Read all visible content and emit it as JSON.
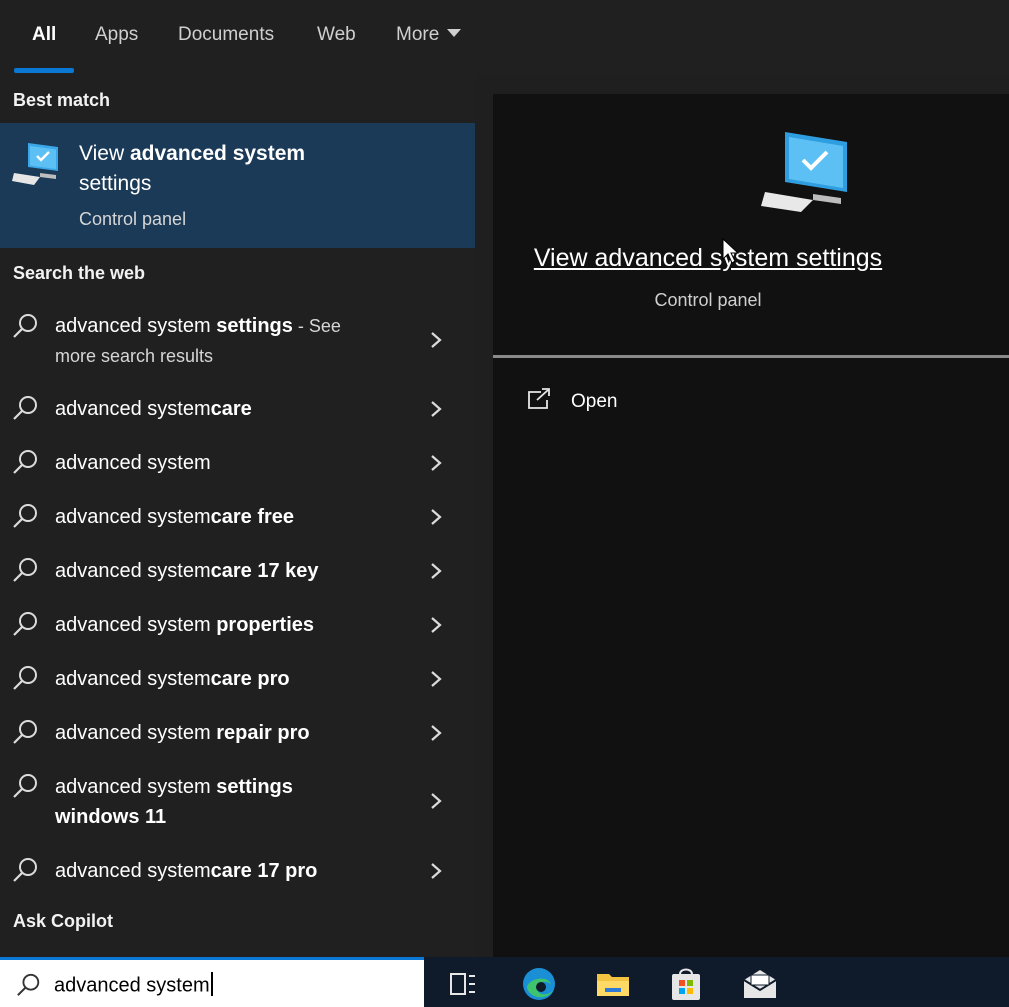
{
  "tabs": [
    {
      "label": "All",
      "active": true
    },
    {
      "label": "Apps"
    },
    {
      "label": "Documents"
    },
    {
      "label": "Web"
    },
    {
      "label": "More"
    }
  ],
  "best_match": {
    "heading": "Best match",
    "title_plain": "View ",
    "title_bold": "advanced system",
    "title_rest": "settings",
    "subtitle": "Control panel",
    "icon": "computer-monitor-icon"
  },
  "web": {
    "heading": "Search the web",
    "items": [
      {
        "plain": "advanced system ",
        "bold": "settings",
        "extra": " - See",
        "line2": "more search results"
      },
      {
        "plain": "advanced system",
        "bold": "care"
      },
      {
        "plain": "advanced system",
        "bold": ""
      },
      {
        "plain": "advanced system",
        "bold": "care free"
      },
      {
        "plain": "advanced system",
        "bold": "care 17 key"
      },
      {
        "plain": "advanced system ",
        "bold": "properties"
      },
      {
        "plain": "advanced system",
        "bold": "care pro"
      },
      {
        "plain": "advanced system ",
        "bold": "repair pro"
      },
      {
        "plain": "advanced system ",
        "bold": "settings",
        "line2_bold": "windows 11"
      },
      {
        "plain": "advanced system",
        "bold": "care 17 pro"
      }
    ]
  },
  "copilot": {
    "heading": "Ask Copilot"
  },
  "preview": {
    "title": "View advanced system settings",
    "subtitle": "Control panel",
    "actions": [
      {
        "label": "Open",
        "icon": "open-external-icon"
      }
    ]
  },
  "search": {
    "value": "advanced system"
  },
  "taskbar": {
    "icons": [
      "task-view-icon",
      "edge-icon",
      "file-explorer-icon",
      "store-icon",
      "mail-icon"
    ]
  },
  "colors": {
    "accent": "#0a78d4",
    "selected_bg": "#1a3a57",
    "pane_bg": "#202020",
    "preview_bg": "#111111"
  }
}
